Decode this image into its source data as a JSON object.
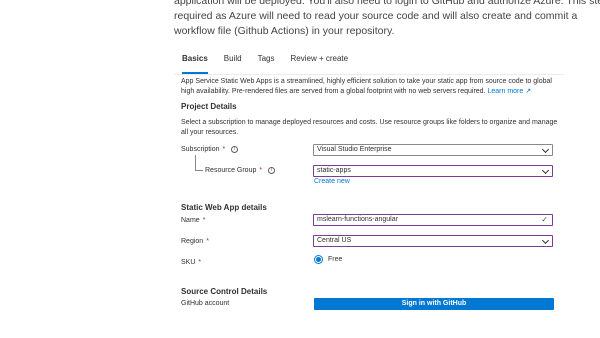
{
  "intro": {
    "line1": "application will be deployed. You'll also need to login to GitHub and authorize Azure. This step is",
    "line2": "required as Azure will need to read your source code and will also create and commit a",
    "line3": "workflow file (Github Actions) in your repository."
  },
  "tabs": [
    {
      "label": "Basics",
      "active": true
    },
    {
      "label": "Build"
    },
    {
      "label": "Tags"
    },
    {
      "label": "Review + create"
    }
  ],
  "description": {
    "text": "App Service Static Web Apps is a streamlined, highly efficient solution to take your static app from source code to global high availability. Pre-rendered files are served from a global footprint with no web servers required.",
    "learn_more": "Learn more",
    "learn_more_icon": "external-link-icon"
  },
  "project_details": {
    "title": "Project Details",
    "help": "Select a subscription to manage deployed resources and costs. Use resource groups like folders to organize and manage all your resources.",
    "subscription_label": "Subscription",
    "subscription_value": "Visual Studio Enterprise",
    "resource_group_label": "Resource Group",
    "resource_group_value": "static-apps",
    "create_new": "Create new"
  },
  "app_details": {
    "title": "Static Web App details",
    "name_label": "Name",
    "name_value": "mslearn-functions-angular",
    "region_label": "Region",
    "region_value": "Central US",
    "sku_label": "SKU",
    "sku_option": "Free"
  },
  "source_control": {
    "title": "Source Control Details",
    "github_label": "GitHub account",
    "sign_in_button": "Sign in with GitHub"
  },
  "required_marker": "*",
  "colors": {
    "accent": "#0078d4",
    "focus_border": "#7a3c9a",
    "required": "#a4262c",
    "valid": "#107c10"
  }
}
